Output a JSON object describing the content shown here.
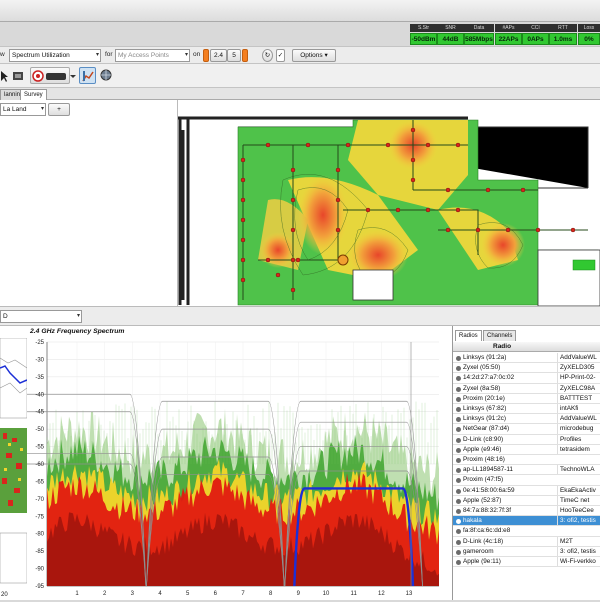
{
  "toolbar": {
    "view_suffix": "w",
    "view_value": "Spectrum Utilization",
    "for_label": "for",
    "for_value": "My Access Points",
    "on_label": "on",
    "band_24": "2.4",
    "band_5": "5",
    "options_label": "Options"
  },
  "stats": [
    {
      "label": "S.Str",
      "value": "-50dBm"
    },
    {
      "label": "SNR",
      "value": "44dB"
    },
    {
      "label": "Data",
      "value": "585Mbps"
    },
    {
      "label": "#APs",
      "value": "22APs"
    },
    {
      "label": "CCI",
      "value": "0APs"
    },
    {
      "label": "RTT",
      "value": "1.0ms"
    },
    {
      "label": "Loss",
      "value": "0%"
    }
  ],
  "tabs": {
    "planning_partial": "lanning",
    "survey": "Survey"
  },
  "floor_select": {
    "value": "La Land",
    "add_label": "+"
  },
  "splitbar_combo": "D",
  "spectrum": {
    "title": "2.4 GHz Frequency Spectrum",
    "y_ticks": [
      "-25",
      "-30",
      "-35",
      "-40",
      "-45",
      "-50",
      "-55",
      "-60",
      "-65",
      "-70",
      "-75",
      "-80",
      "-85",
      "-90",
      "-95"
    ],
    "x_ticks": [
      "1",
      "2",
      "3",
      "4",
      "5",
      "6",
      "7",
      "8",
      "9",
      "10",
      "11",
      "12",
      "13"
    ],
    "left_label": "20"
  },
  "chart_data": {
    "type": "area",
    "title": "2.4 GHz Frequency Spectrum",
    "xlabel": "",
    "ylabel": "",
    "x_categories": [
      "1",
      "2",
      "3",
      "4",
      "5",
      "6",
      "7",
      "8",
      "9",
      "10",
      "11",
      "12",
      "13"
    ],
    "ylim": [
      -95,
      -25
    ],
    "highlighted_channel_band": {
      "from_channel": 9,
      "to_channel": 13,
      "level_dBm": -67
    },
    "colors": {
      "highlight": "#1c2fd6",
      "hot": "#e21a10",
      "warm": "#f3d52a",
      "mild": "#4aa93a",
      "outline": "#8f8f8f"
    }
  },
  "radios": {
    "tabs": [
      "Radios",
      "Channels"
    ],
    "header": "Radio",
    "rows": [
      {
        "name": "Linksys (91:2a)",
        "ssid": "AddValueWL"
      },
      {
        "name": "Zyxel (05:50)",
        "ssid": "ZyXELD305"
      },
      {
        "name": "14:2d:27:a7:0c:02",
        "ssid": "HP-Print-02-"
      },
      {
        "name": "Zyxel (8a:58)",
        "ssid": "ZyXELC98A"
      },
      {
        "name": "Proxim (20:1e)",
        "ssid": "BATTTEST"
      },
      {
        "name": "Linksys (67:82)",
        "ssid": "intAKfi"
      },
      {
        "name": "Linksys (91:2c)",
        "ssid": "AddValueWL"
      },
      {
        "name": "NetGear (87:d4)",
        "ssid": "microdebug"
      },
      {
        "name": "D-Link (c8:90)",
        "ssid": "Profiles"
      },
      {
        "name": "Apple (e9:46)",
        "ssid": "tetrasidem"
      },
      {
        "name": "Proxim (48:16)",
        "ssid": ""
      },
      {
        "name": "ap-LL1894587-11",
        "ssid": "TechnoWLA"
      },
      {
        "name": "Proxim (47:f5)",
        "ssid": ""
      },
      {
        "name": "0e:41:58:00:6a:59",
        "ssid": "EkaEkaActiv"
      },
      {
        "name": "Apple (52:87)",
        "ssid": "TimeC net"
      },
      {
        "name": "84:7a:88:32:7f:3f",
        "ssid": "HooTeeCee"
      },
      {
        "name": "hakala",
        "ssid": "3: ofi2, testis"
      },
      {
        "name": "fa:8f:ca:6c:dd:e8",
        "ssid": ""
      },
      {
        "name": "D-Link (4c:18)",
        "ssid": "M2T"
      },
      {
        "name": "gameroom",
        "ssid": "3: ofi2, testis"
      },
      {
        "name": "Apple (9e:11)",
        "ssid": "Wi-Fi-verkko"
      }
    ],
    "selected_index": 16
  }
}
